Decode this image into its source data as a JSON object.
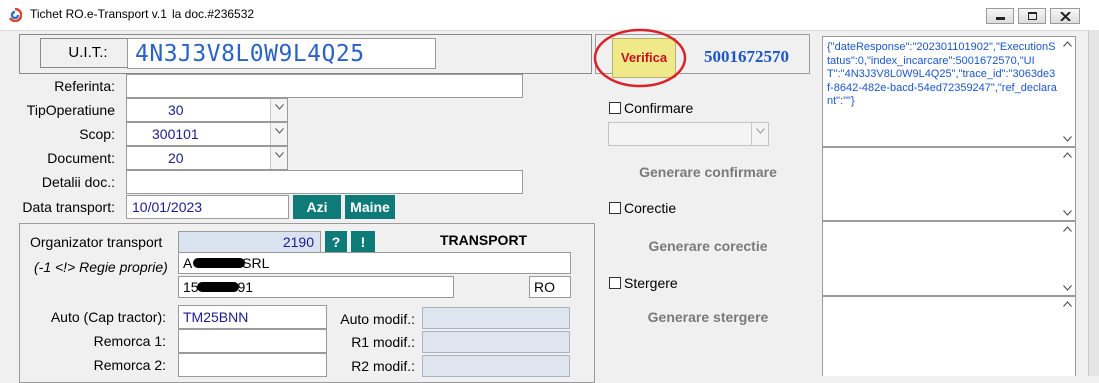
{
  "window": {
    "title": "Tichet RO.e-Transport v.1",
    "doc_label": "la doc.#236532",
    "icons": [
      "app-icon",
      "minimize-icon",
      "restore-icon",
      "close-icon"
    ]
  },
  "uit": {
    "label": "U.I.T.:",
    "value": "4N3J3V8L0W9L4Q25"
  },
  "verify": {
    "button_label": "Verifica",
    "index": "5001672570",
    "accent": "#f0e98a",
    "highlight": "#d8232a"
  },
  "form": {
    "referinta": {
      "label": "Referinta:",
      "value": ""
    },
    "tip_operatiune": {
      "label": "TipOperatiune",
      "value": "30"
    },
    "scop": {
      "label": "Scop:",
      "value": "300101"
    },
    "document": {
      "label": "Document:",
      "value": "20"
    },
    "detalii": {
      "label": "Detalii doc.:",
      "value": ""
    },
    "data_transport": {
      "label": "Data transport:",
      "value": "10/01/2023",
      "btn_today": "Azi",
      "btn_tomorrow": "Maine"
    }
  },
  "transport": {
    "heading": "TRANSPORT",
    "organizator_label": "Organizator transport",
    "organizator_code": "2190",
    "btn_question": "?",
    "btn_excl": "!",
    "regie_label": "(-1 <!> Regie proprie)",
    "company_name_visible": "A          A SRL",
    "company_id_visible": "15          91",
    "country": "RO",
    "auto_label": "Auto (Cap tractor):",
    "auto_value": "TM25BNN",
    "auto_modif_label": "Auto modif.:",
    "remorca1_label": "Remorca 1:",
    "r1_modif_label": "R1 modif.:",
    "remorca2_label": "Remorca 2:",
    "r2_modif_label": "R2 modif.:"
  },
  "actions": {
    "confirmare_label": "Confirmare",
    "generare_confirmare": "Generare confirmare",
    "corectie_label": "Corectie",
    "generare_corectie": "Generare corectie",
    "stergere_label": "Stergere",
    "generare_stergere": "Generare stergere"
  },
  "response": {
    "json_text": "{\"dateResponse\":\"202301101902\",\"ExecutionStatus\":0,\"index_incarcare\":5001672570,\"UIT\":\"4N3J3V8L0W9L4Q25\",\"trace_id\":\"3063de3f-8642-482e-bacd-54ed72359247\",\"ref_declarant\":\"\"}"
  }
}
